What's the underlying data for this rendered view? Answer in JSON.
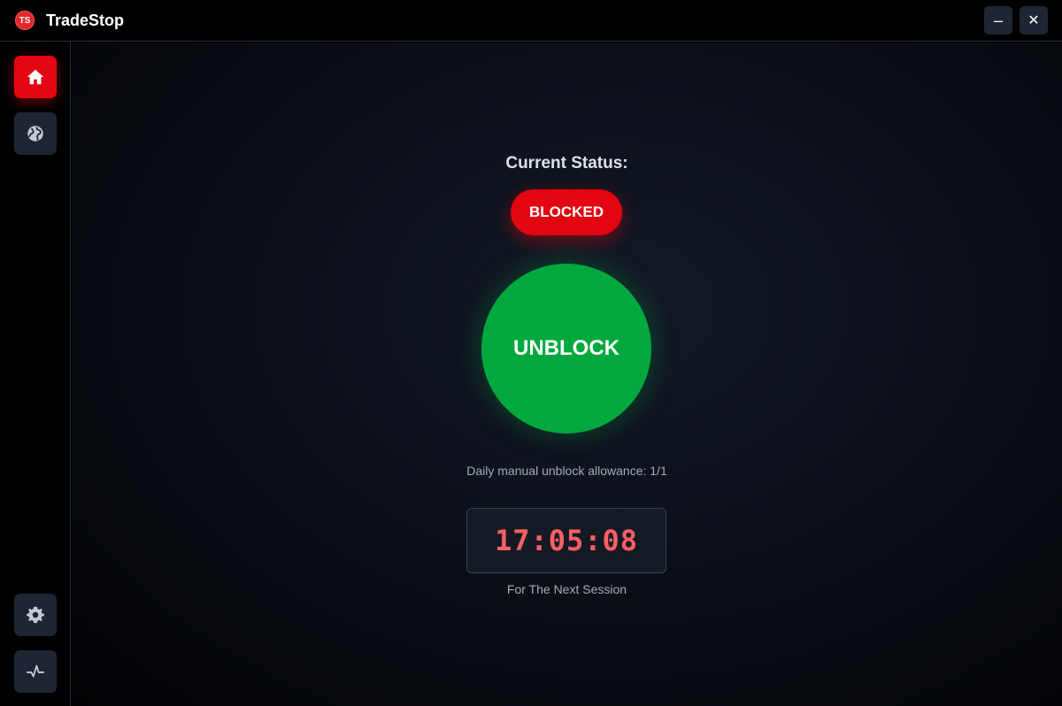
{
  "window": {
    "logo_text": "TS",
    "title": "TradeStop",
    "minimize_label": "–",
    "close_label": "✕"
  },
  "sidebar": {
    "items": [
      {
        "name": "home",
        "icon": "home-icon",
        "active": true
      },
      {
        "name": "globe",
        "icon": "globe-icon",
        "active": false
      },
      {
        "name": "settings",
        "icon": "gear-icon",
        "active": false
      },
      {
        "name": "activity",
        "icon": "activity-icon",
        "active": false
      }
    ]
  },
  "main": {
    "status_label": "Current Status:",
    "status_value": "BLOCKED",
    "unblock_label": "UNBLOCK",
    "allowance_text": "Daily manual unblock allowance: 1/1",
    "timer": "17:05:08",
    "timer_caption": "For The Next Session"
  },
  "colors": {
    "blocked_red": "#e3050f",
    "unblock_green": "#00a83d",
    "timer_red": "#ff5f63",
    "panel_bg": "#1e2633"
  }
}
